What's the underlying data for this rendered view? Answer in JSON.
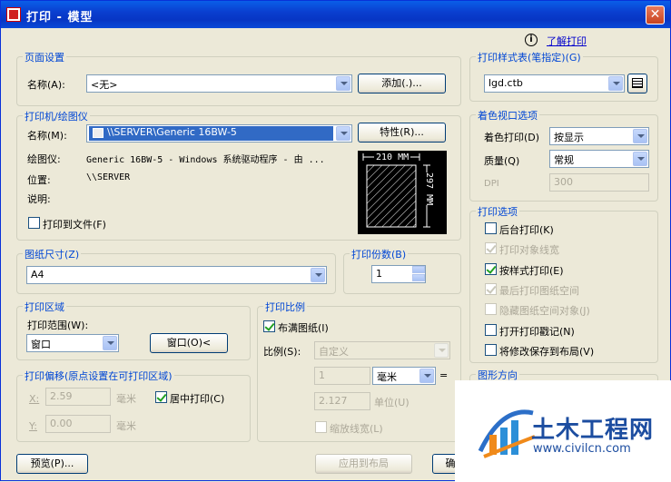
{
  "window": {
    "title": "打印 - 模型"
  },
  "help": {
    "label": "了解打印"
  },
  "page_setup": {
    "group_label": "页面设置",
    "name_label": "名称(A):",
    "name_value": "<无>",
    "add_button": "添加(.)..."
  },
  "printer": {
    "group_label": "打印机/绘图仪",
    "name_label": "名称(M):",
    "name_value": "\\\\SERVER\\Generic 16BW-5",
    "properties_button": "特性(R)...",
    "plotter_label": "绘图仪:",
    "plotter_value": "Generic 16BW-5 - Windows 系统驱动程序 - 由 ...",
    "location_label": "位置:",
    "location_value": "\\\\SERVER",
    "desc_label": "说明:",
    "print_to_file": "打印到文件(F)",
    "preview_width": "210 MM",
    "preview_height": "297 MM"
  },
  "paper_size": {
    "group_label": "图纸尺寸(Z)",
    "value": "A4"
  },
  "copies": {
    "group_label": "打印份数(B)",
    "value": "1"
  },
  "plot_area": {
    "group_label": "打印区域",
    "range_label": "打印范围(W):",
    "range_value": "窗口",
    "window_button": "窗口(O)<"
  },
  "plot_offset": {
    "group_label": "打印偏移(原点设置在可打印区域)",
    "x_label": "X:",
    "x_value": "2.59",
    "y_label": "Y:",
    "y_value": "0.00",
    "unit": "毫米",
    "center": "居中打印(C)"
  },
  "plot_scale": {
    "group_label": "打印比例",
    "fit": "布满图纸(I)",
    "scale_label": "比例(S):",
    "scale_value": "自定义",
    "value1": "1",
    "unit_value": "毫米",
    "equals": "=",
    "value2": "2.127",
    "unit_label": "单位(U)",
    "scale_lineweights": "缩放线宽(L)"
  },
  "style_table": {
    "group_label": "打印样式表(笔指定)(G)",
    "value": "lgd.ctb"
  },
  "shaded": {
    "group_label": "着色视口选项",
    "shade_label": "着色打印(D)",
    "shade_value": "按显示",
    "quality_label": "质量(Q)",
    "quality_value": "常规",
    "dpi_label": "DPI",
    "dpi_value": "300"
  },
  "options": {
    "group_label": "打印选项",
    "items": [
      {
        "label": "后台打印(K)",
        "checked": false,
        "disabled": false
      },
      {
        "label": "打印对象线宽",
        "checked": true,
        "disabled": true
      },
      {
        "label": "按样式打印(E)",
        "checked": true,
        "disabled": false
      },
      {
        "label": "最后打印图纸空间",
        "checked": true,
        "disabled": true
      },
      {
        "label": "隐藏图纸空间对象(J)",
        "checked": false,
        "disabled": true
      },
      {
        "label": "打开打印戳记(N)",
        "checked": false,
        "disabled": false
      },
      {
        "label": "将修改保存到布局(V)",
        "checked": false,
        "disabled": false
      }
    ]
  },
  "orientation": {
    "group_label": "图形方向"
  },
  "footer": {
    "preview_button": "预览(P)...",
    "apply_button": "应用到布局",
    "ok_button": "确"
  },
  "watermark": {
    "name": "土木工程网",
    "url": "www.civilcn.com"
  }
}
